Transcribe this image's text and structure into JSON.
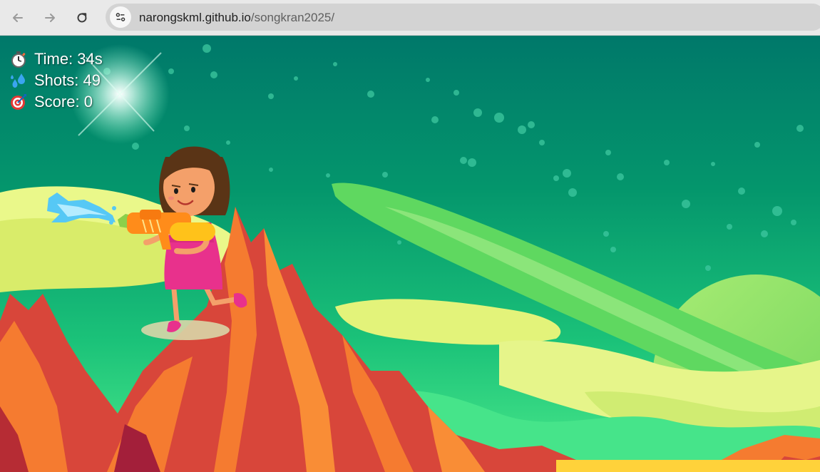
{
  "browser": {
    "url_domain": "narongskml.github.io",
    "url_path": "/songkran2025/"
  },
  "hud": {
    "time_label": "Time: 34s",
    "shots_label": "Shots: 49",
    "score_label": "Score: 0"
  },
  "icons": {
    "back": "arrow-left-icon",
    "forward": "arrow-right-icon",
    "reload": "reload-icon",
    "site_info": "tune-icon",
    "time": "stopwatch-icon",
    "shots": "water-drops-icon",
    "score": "target-icon"
  },
  "colors": {
    "sky_top": "#00786a",
    "sky_mid": "#14b070",
    "rock_red": "#d8463a",
    "rock_orange": "#f57b30",
    "cloud_yellow": "#eaf88a",
    "planet_green": "#8ee06a",
    "dress_pink": "#e8318c"
  }
}
